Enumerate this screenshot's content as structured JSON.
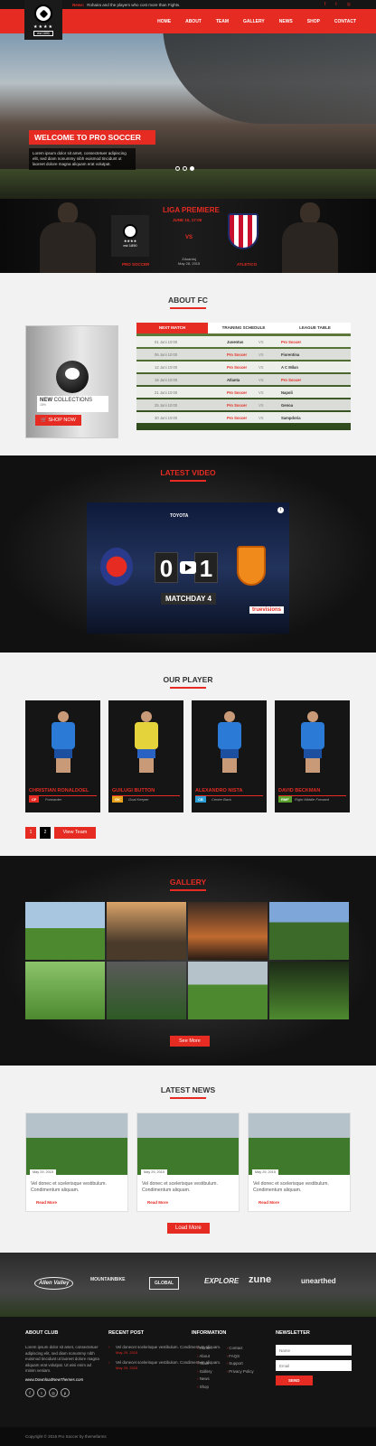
{
  "topbar": {
    "news_label": "News:",
    "news_text": "Rohaira and the players who cost more than Fights.",
    "social": [
      "f-icon",
      "t-icon",
      "instagram-icon"
    ]
  },
  "logo": {
    "stars": "★★★★",
    "est": "est 1890"
  },
  "nav": [
    "HOME",
    "ABOUT",
    "TEAM",
    "GALLERY",
    "NEWS",
    "SHOP",
    "CONTACT"
  ],
  "hero": {
    "title": "WELCOME TO PRO SOCCER",
    "text": "Lorem ipsum dolor sit amet, consectetuer adipiscing elit, sed diam nonummy nibh euismod tincidunt ut laoreet dolore magna aliquam erat volutpat."
  },
  "match": {
    "league": "LIGA PREMIERE",
    "date": "JUNE 10, 17:00",
    "vs": "VS",
    "team1": "PRO SOCCER",
    "team2": "ATLETICO",
    "location": "Zduarduj",
    "location_date": "May 28, 2015",
    "logo_stars": "★★★★",
    "logo_est": "est 1890"
  },
  "about": {
    "title": "ABOUT FC",
    "collection": {
      "title_bold": "NEW",
      "title_rest": " COLLECTIONS",
      "sub": "15%",
      "button": "SHOP NOW"
    },
    "tabs": [
      "NEXT MATCH",
      "TRAINING SCHEDULE",
      "LEAGUE TABLE"
    ],
    "fixtures": [
      {
        "date": "01 Juni 10:00",
        "home": "Juventus",
        "vs": "VS",
        "away": "Pro Soccer",
        "home_hl": false
      },
      {
        "date": "06 Juni 10:00",
        "home": "Pro Soccer",
        "vs": "VS",
        "away": "Fiorentina",
        "home_hl": true
      },
      {
        "date": "12 Juni 10:00",
        "home": "Pro Soccer",
        "vs": "VS",
        "away": "A C Milan",
        "home_hl": true
      },
      {
        "date": "16 Juni 10:00",
        "home": "Atlanta",
        "vs": "VS",
        "away": "Pro Soccer",
        "home_hl": false
      },
      {
        "date": "21 Juni 10:00",
        "home": "Pro Soccer",
        "vs": "VS",
        "away": "Napoli",
        "home_hl": true
      },
      {
        "date": "25 Juni 10:00",
        "home": "Pro Soccer",
        "vs": "VS",
        "away": "Genoa",
        "home_hl": true
      },
      {
        "date": "30 Juni 10:00",
        "home": "Pro Soccer",
        "vs": "VS",
        "away": "Sampdoria",
        "home_hl": true
      }
    ]
  },
  "video": {
    "title": "LATEST VIDEO",
    "sponsor": "TOYOTA",
    "score_home": "0",
    "score_away": "1",
    "matchday": "MATCHDAY 4",
    "broadcaster": "truevisions"
  },
  "players": {
    "title": "OUR PLAYER",
    "list": [
      {
        "name": "CHRISTIAN RONALDOEL",
        "badge": "CF",
        "badge_color": "#e52b22",
        "position": "Forwarder",
        "shirt": "#2a7ad6",
        "shorts": "#1d4fa0"
      },
      {
        "name": "GUILUGI BUTTON",
        "badge": "GK",
        "badge_color": "#e7a21b",
        "position": "Goal Keeper",
        "shirt": "#e5d33b",
        "shorts": "#2a62c4"
      },
      {
        "name": "ALEXANDRO NISTA",
        "badge": "CB",
        "badge_color": "#2a9fd6",
        "position": "Center Back",
        "shirt": "#2a7ad6",
        "shorts": "#1d4fa0"
      },
      {
        "name": "DAVID BECKMAN",
        "badge": "RMF",
        "badge_color": "#5aa02c",
        "position": "Right Middle Forward",
        "shirt": "#2a7ad6",
        "shorts": "#1d4fa0"
      }
    ],
    "pager": [
      "1",
      "2"
    ],
    "view_team": "View Team"
  },
  "gallery": {
    "title": "GALLERY",
    "see_more": "See More",
    "images": [
      {
        "name": "gallery-image-field",
        "bg": "linear-gradient(180deg,#a9c6e0 0 45%,#4d8a2f 45%)"
      },
      {
        "name": "gallery-image-silhouette",
        "bg": "linear-gradient(180deg,#dba46a,#4a3a2a 70%)"
      },
      {
        "name": "gallery-image-sunset-ball",
        "bg": "linear-gradient(180deg,#3b2a22,#c06a30 60%,#2a1c14)"
      },
      {
        "name": "gallery-image-team-huddle",
        "bg": "linear-gradient(180deg,#7fa6d8 0 35%,#3c6a28 35%)"
      },
      {
        "name": "gallery-image-match-action",
        "bg": "linear-gradient(180deg,#8bc36a,#4d8a2f)"
      },
      {
        "name": "gallery-image-crowd",
        "bg": "linear-gradient(180deg,#5a5a5a,#2d5a24)"
      },
      {
        "name": "gallery-image-players-run",
        "bg": "linear-gradient(180deg,#b5c2c9 0 40%,#4d8a2f 40%)"
      },
      {
        "name": "gallery-image-tackle",
        "bg": "linear-gradient(180deg,#1c2a16,#4d8a2f)"
      }
    ]
  },
  "news": {
    "title": "LATEST NEWS",
    "items": [
      {
        "date": "May 29, 2015",
        "text": "Vel donec et scelerisque vestibulum. Condimentum aliquam.",
        "more": "Read More"
      },
      {
        "date": "May 29, 2015",
        "text": "Vel donec et scelerisque vestibulum. Condimentum aliquam.",
        "more": "Read More"
      },
      {
        "date": "May 29, 2015",
        "text": "Vel donec et scelerisque vestibulum. Condimentum aliquam.",
        "more": "Read More"
      }
    ],
    "load_more": "Load More"
  },
  "sponsors": [
    "Allen Valley",
    "MOUNTAINBIKE",
    "GLOBAL",
    "EXPLORE",
    "zune",
    "unearthed"
  ],
  "footer": {
    "about_title": "ABOUT CLUB",
    "about_text": "Lorem ipsum dolor sit amet, consectetuer adipiscing elit, sed diam nonummy nibh euismod tincidunt ut laoreet dolore magna aliquam erat volutpat. Ut wisi enim ad minim veniam.",
    "site": "www.DownloadNewThemes.com",
    "recent_title": "RECENT POST",
    "recent": [
      {
        "text": "Vel donecet scelerisque vestibulum. Condimentum aliquam.",
        "date": "May 29, 2015"
      },
      {
        "text": "Vel donecet scelerisque vestibulum. Condimentum aliquam.",
        "date": "May 29, 2015"
      }
    ],
    "info_title": "INFORMATION",
    "info_col1": [
      "Home",
      "About",
      "Team",
      "Gallery",
      "News",
      "Shop"
    ],
    "info_col2": [
      "Contact",
      "FAQS",
      "Support",
      "Privacy Policy"
    ],
    "newsletter_title": "NEWSLETTER",
    "name_placeholder": "Name",
    "email_placeholder": "Email",
    "send": "SEND",
    "social": [
      "f",
      "t",
      "ig",
      "p"
    ]
  },
  "copyright": "Copyright © 2015 Pro Soccer by themefarms"
}
